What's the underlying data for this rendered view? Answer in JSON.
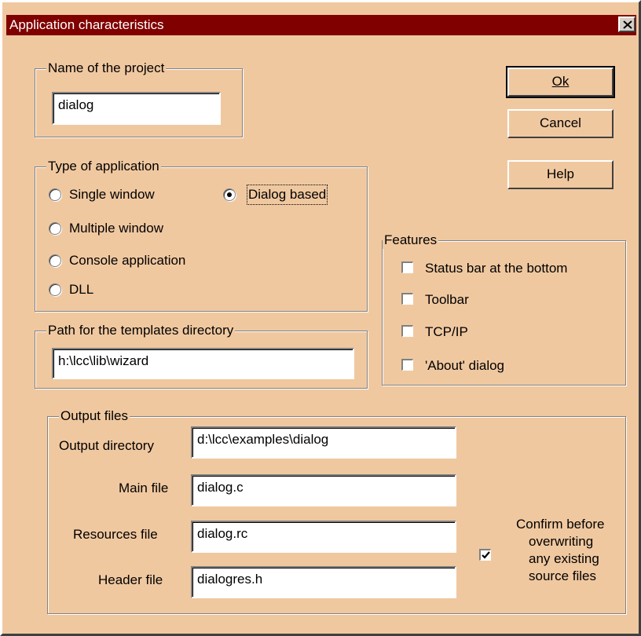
{
  "colors": {
    "face": "#f0c8a0",
    "title": "#800000"
  },
  "window": {
    "title": "Application characteristics",
    "close_icon": "close-icon"
  },
  "buttons": {
    "ok": "Ok",
    "cancel": "Cancel",
    "help": "Help"
  },
  "project": {
    "legend": "Name of the project",
    "value": "dialog"
  },
  "app_type": {
    "legend": "Type of application",
    "options": [
      "Single window",
      "Dialog based",
      "Multiple window",
      "Console application",
      "DLL"
    ],
    "selected": "Dialog based"
  },
  "templates": {
    "legend": "Path for the templates directory",
    "value": "h:\\lcc\\lib\\wizard"
  },
  "features": {
    "legend": "Features",
    "items": [
      {
        "label": "Status bar at the bottom",
        "checked": false
      },
      {
        "label": "Toolbar",
        "checked": false
      },
      {
        "label": "TCP/IP",
        "checked": false
      },
      {
        "label": "'About' dialog",
        "checked": false
      }
    ]
  },
  "output": {
    "legend": "Output files",
    "directory_label": "Output directory",
    "directory_value": "d:\\lcc\\examples\\dialog",
    "main_label": "Main file",
    "main_value": "dialog.c",
    "resources_label": "Resources file",
    "resources_value": "dialog.rc",
    "header_label": "Header file",
    "header_value": "dialogres.h",
    "confirm_label_1": "Confirm before",
    "confirm_label_2": "overwriting",
    "confirm_label_3": "any existing",
    "confirm_label_4": "source files",
    "confirm_checked": true
  }
}
